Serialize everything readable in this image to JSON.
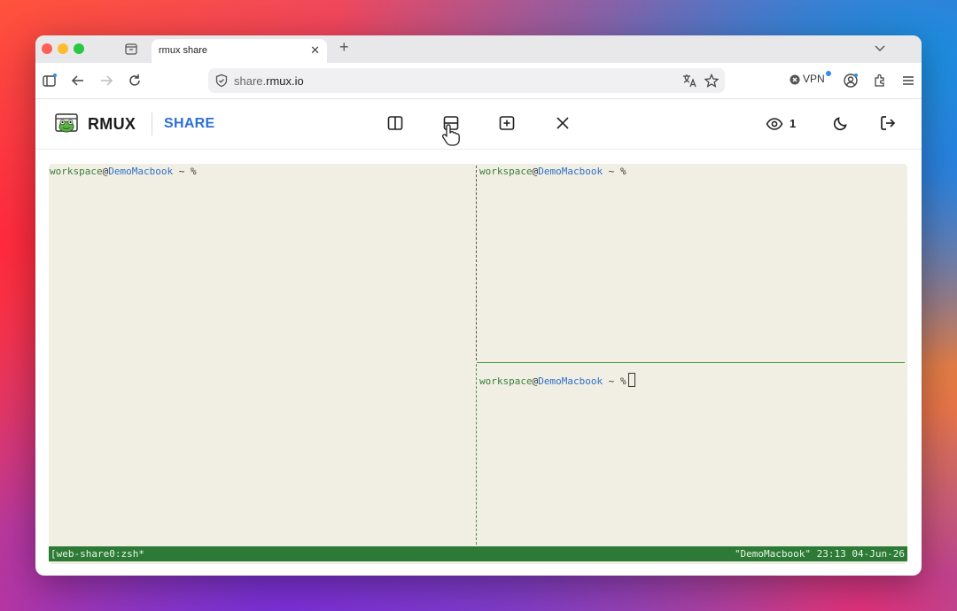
{
  "browser": {
    "tab_title": "rmux share",
    "tab_close": "✕",
    "new_tab": "+",
    "url_prefix": "share.",
    "url_domain": "rmux.io",
    "vpn_label": "VPN"
  },
  "app": {
    "brand": "RMUX",
    "subtitle": "SHARE",
    "viewer_count": "1",
    "colors": {
      "brand_blue": "#2f6fd6",
      "status_green": "#2d7a36",
      "terminal_bg": "#f1efe4"
    }
  },
  "terminal": {
    "panes": [
      {
        "user": "workspace",
        "at": "@",
        "host": "DemoMacbook",
        "rest": " ~ %"
      },
      {
        "user": "workspace",
        "at": "@",
        "host": "DemoMacbook",
        "rest": " ~ %"
      },
      {
        "user": "workspace",
        "at": "@",
        "host": "DemoMacbook",
        "rest": " ~ %"
      }
    ],
    "status_left": "[web-share0:zsh*",
    "status_right": "\"DemoMacbook\" 23:13 04-Jun-26"
  },
  "icons": {
    "toolbar": [
      "split-vertical-icon",
      "split-horizontal-icon",
      "new-window-icon",
      "close-pane-icon"
    ],
    "header_right": [
      "eye-icon",
      "moon-icon",
      "logout-icon"
    ]
  }
}
